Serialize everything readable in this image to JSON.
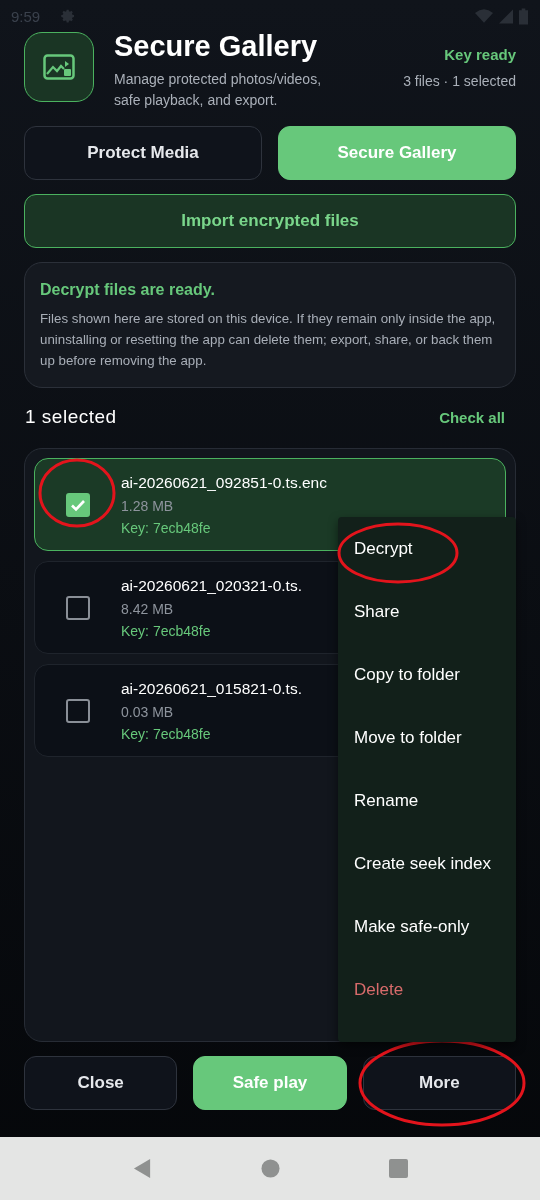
{
  "status_bar": {
    "time": "9:59"
  },
  "header": {
    "title": "Secure Gallery",
    "subtitle": "Manage protected photos/videos, safe playback, and export.",
    "key_status": "Key ready",
    "counts": "3 files · 1 selected"
  },
  "tabs": [
    {
      "label": "Protect Media",
      "selected": false
    },
    {
      "label": "Secure Gallery",
      "selected": true
    }
  ],
  "import_button": "Import encrypted files",
  "notice": {
    "title": "Decrypt files are ready.",
    "body": "Files shown here are stored on this device. If they remain only inside the app, uninstalling or resetting the app can delete them; export, share, or back them up before removing the app."
  },
  "selection": {
    "label": "1 selected",
    "check_all": "Check all"
  },
  "files": [
    {
      "name": "ai-20260621_092851-0.ts.enc",
      "size": "1.28 MB",
      "key": "Key: 7ecb48fe",
      "checked": true,
      "annotated": true
    },
    {
      "name": "ai-20260621_020321-0.ts.",
      "size": "8.42 MB",
      "key": "Key: 7ecb48fe",
      "checked": false,
      "annotated": false
    },
    {
      "name": "ai-20260621_015821-0.ts.",
      "size": "0.03 MB",
      "key": "Key: 7ecb48fe",
      "checked": false,
      "annotated": false
    }
  ],
  "menu": [
    {
      "label": "Decrypt",
      "kind": "action",
      "annotated": true
    },
    {
      "label": "Share",
      "kind": "action",
      "annotated": false
    },
    {
      "label": "Copy to folder",
      "kind": "action",
      "annotated": false
    },
    {
      "label": "Move to folder",
      "kind": "action",
      "annotated": false
    },
    {
      "label": "Rename",
      "kind": "action",
      "annotated": false
    },
    {
      "label": "Create seek index",
      "kind": "action",
      "annotated": false
    },
    {
      "label": "Make safe-only",
      "kind": "action",
      "annotated": false
    },
    {
      "label": "Delete",
      "kind": "danger",
      "annotated": false
    }
  ],
  "bottom_buttons": [
    {
      "label": "Close",
      "kind": "outline",
      "annotated": false
    },
    {
      "label": "Safe play",
      "kind": "primary",
      "annotated": false
    },
    {
      "label": "More",
      "kind": "outline",
      "annotated": true
    }
  ]
}
